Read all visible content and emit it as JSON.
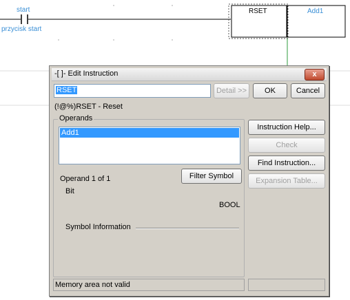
{
  "ladder": {
    "contact_label": "start",
    "contact_comment": "przycisk start",
    "instruction_box_label": "RSET",
    "operand_box_label": "Add1"
  },
  "dialog": {
    "title": "-[ ]- Edit Instruction",
    "close_label": "x",
    "instruction_input": "RSET",
    "detail_button": "Detail >>",
    "ok_button": "OK",
    "cancel_button": "Cancel",
    "description": "(!@%)RSET - Reset",
    "operands_group": "Operands",
    "operand_items": [
      "Add1"
    ],
    "operand_counter": "Operand 1 of 1",
    "operand_type": "Bit",
    "data_type": "BOOL",
    "filter_symbol_button": "Filter Symbol",
    "symbol_info_label": "Symbol Information",
    "instruction_help_button": "Instruction Help...",
    "check_button": "Check",
    "find_instruction_button": "Find Instruction...",
    "expansion_table_button": "Expansion Table...",
    "status_text": "Memory area not valid"
  },
  "colors": {
    "accent": "#3a8fd6",
    "selection": "#3399ff",
    "dialog_bg": "#d4d0c8"
  }
}
